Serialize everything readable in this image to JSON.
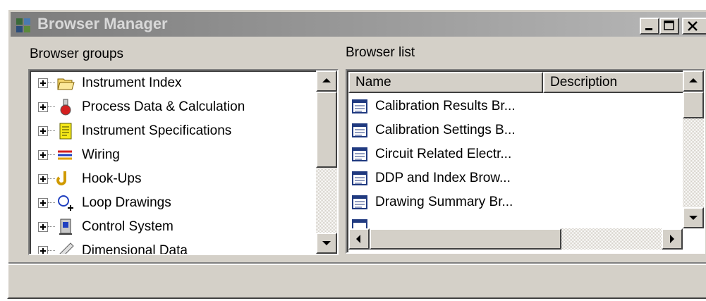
{
  "window": {
    "title": "Browser Manager",
    "icon": "browser-manager-icon",
    "controls": [
      "minimize-icon",
      "maximize-icon",
      "close-icon"
    ]
  },
  "groups": {
    "label": "Browser groups",
    "items": [
      {
        "label": "Instrument Index",
        "icon": "folder-icon"
      },
      {
        "label": "Process Data & Calculation",
        "icon": "flask-icon"
      },
      {
        "label": "Instrument Specifications",
        "icon": "spec-sheet-icon"
      },
      {
        "label": "Wiring",
        "icon": "wiring-icon"
      },
      {
        "label": "Hook-Ups",
        "icon": "hook-icon"
      },
      {
        "label": "Loop Drawings",
        "icon": "loop-icon"
      },
      {
        "label": "Control System",
        "icon": "control-system-icon"
      },
      {
        "label": "Dimensional Data",
        "icon": "ruler-icon"
      }
    ]
  },
  "list": {
    "label": "Browser list",
    "columns": [
      "Name",
      "Description"
    ],
    "rows": [
      {
        "name": "Calibration Results Br...",
        "description": ""
      },
      {
        "name": "Calibration Settings B...",
        "description": ""
      },
      {
        "name": "Circuit Related Electr...",
        "description": ""
      },
      {
        "name": "DDP and Index Brow...",
        "description": ""
      },
      {
        "name": "Drawing Summary Br...",
        "description": ""
      }
    ]
  },
  "colors": {
    "titlebar_inactive": "#8c8c8c",
    "face": "#d4d0c8"
  }
}
